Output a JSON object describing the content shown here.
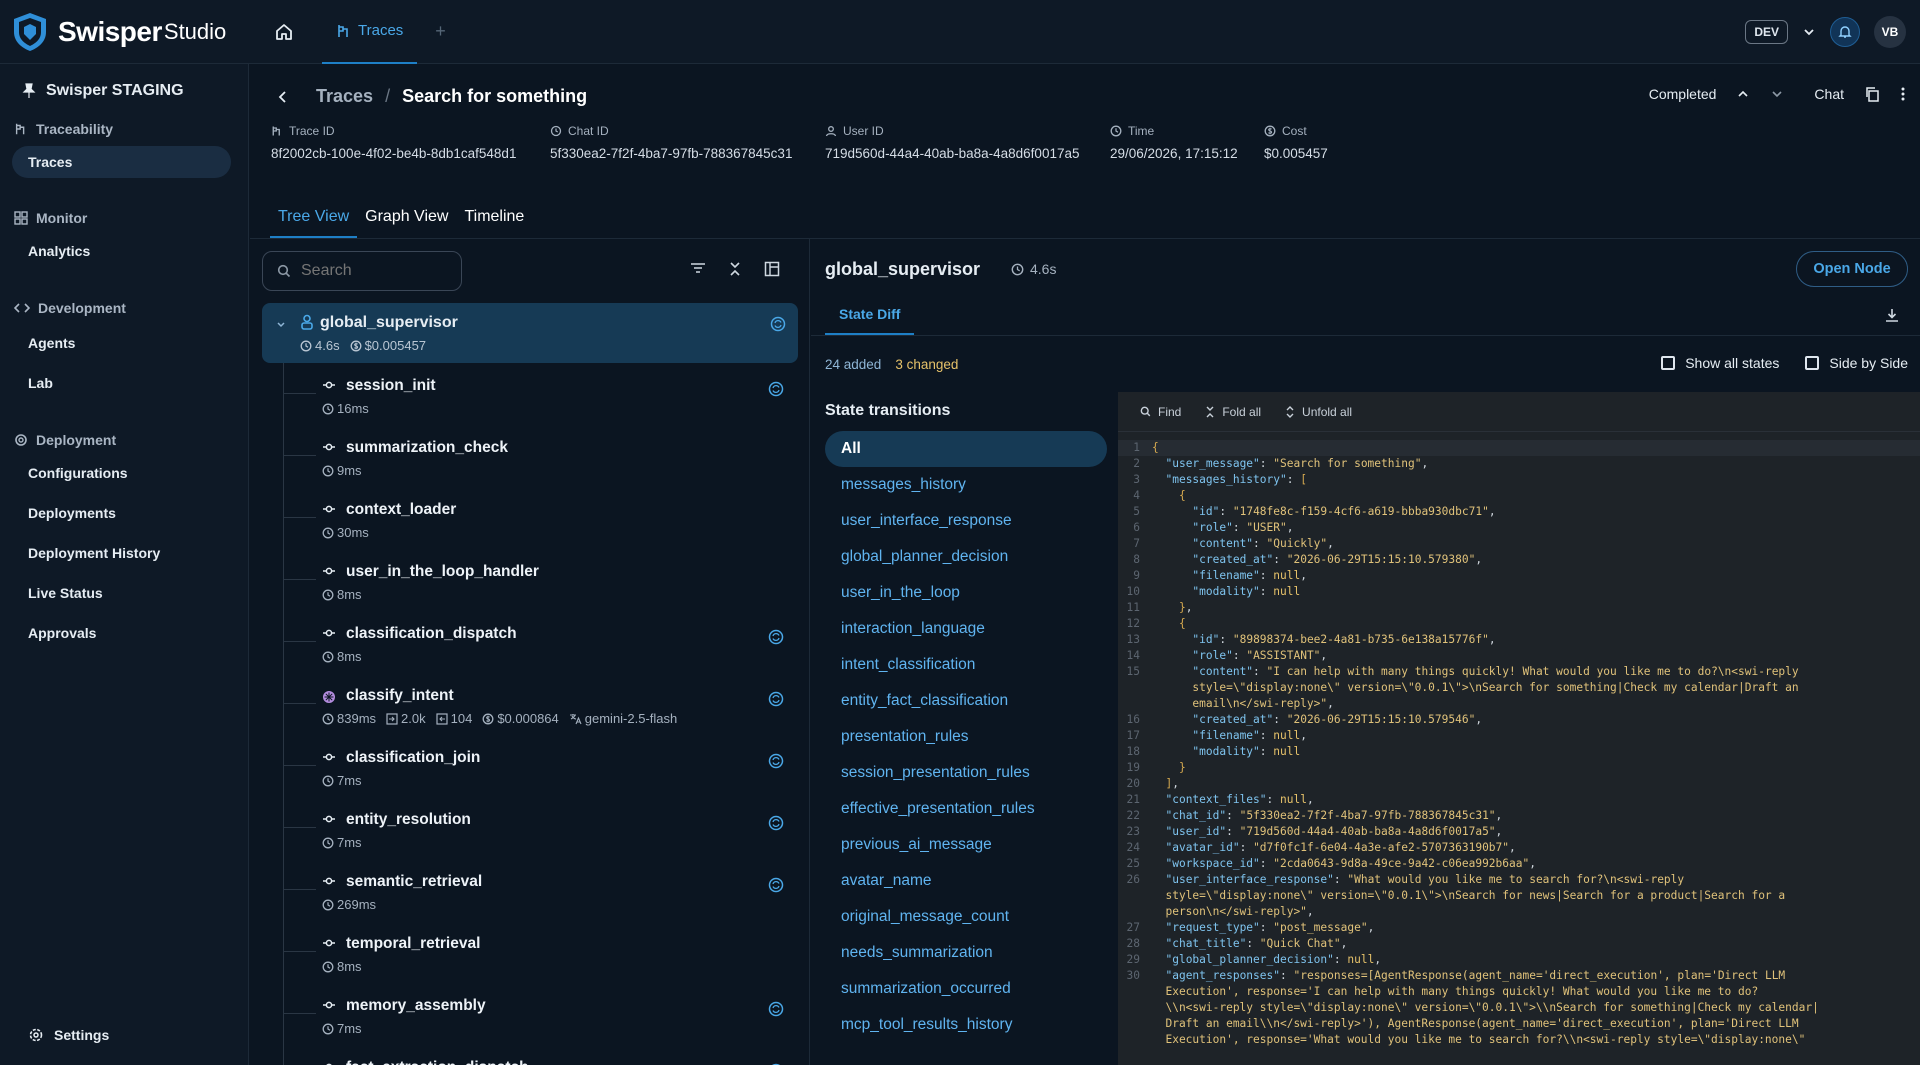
{
  "app": {
    "brand": "Swisper",
    "brand_suffix": "Studio",
    "env": "DEV",
    "user_initials": "VB"
  },
  "topbar": {
    "tab_label": "Traces"
  },
  "sidebar": {
    "workspace": "Swisper STAGING",
    "sections": {
      "traceability": "Traceability",
      "monitor": "Monitor",
      "development": "Development",
      "deployment": "Deployment"
    },
    "items": {
      "traces": "Traces",
      "analytics": "Analytics",
      "agents": "Agents",
      "lab": "Lab",
      "configurations": "Configurations",
      "deployments": "Deployments",
      "deployment_history": "Deployment History",
      "live_status": "Live Status",
      "approvals": "Approvals"
    },
    "settings": "Settings"
  },
  "header": {
    "breadcrumb_parent": "Traces",
    "breadcrumb_sep": "/",
    "title": "Search for something",
    "status": "Completed",
    "chat": "Chat",
    "meta": {
      "trace_id_label": "Trace ID",
      "trace_id": "8f2002cb-100e-4f02-be4b-8db1caf548d1",
      "chat_id_label": "Chat ID",
      "chat_id": "5f330ea2-7f2f-4ba7-97fb-788367845c31",
      "user_id_label": "User ID",
      "user_id": "719d560d-44a4-40ab-ba8a-4a8d6f0017a5",
      "time_label": "Time",
      "time": "29/06/2026, 17:15:12",
      "cost_label": "Cost",
      "cost": "$0.005457"
    },
    "tabs": {
      "tree": "Tree View",
      "graph": "Graph View",
      "timeline": "Timeline"
    }
  },
  "tree": {
    "search_placeholder": "Search",
    "root": {
      "name": "global_supervisor",
      "duration": "4.6s",
      "cost": "$0.005457"
    },
    "nodes": [
      {
        "name": "session_init",
        "duration": "16ms",
        "badge": true
      },
      {
        "name": "summarization_check",
        "duration": "9ms",
        "badge": false
      },
      {
        "name": "context_loader",
        "duration": "30ms",
        "badge": false
      },
      {
        "name": "user_in_the_loop_handler",
        "duration": "8ms",
        "badge": false
      },
      {
        "name": "classification_dispatch",
        "duration": "8ms",
        "badge": true
      },
      {
        "name": "classify_intent",
        "duration": "839ms",
        "tokens_in": "2.0k",
        "tokens_out": "104",
        "cost": "$0.000864",
        "model": "gemini-2.5-flash",
        "badge": true,
        "llm": true
      },
      {
        "name": "classification_join",
        "duration": "7ms",
        "badge": true
      },
      {
        "name": "entity_resolution",
        "duration": "7ms",
        "badge": true
      },
      {
        "name": "semantic_retrieval",
        "duration": "269ms",
        "badge": true
      },
      {
        "name": "temporal_retrieval",
        "duration": "8ms",
        "badge": false
      },
      {
        "name": "memory_assembly",
        "duration": "7ms",
        "badge": true
      },
      {
        "name": "fact_extraction_dispatch",
        "duration": "",
        "badge": true
      }
    ]
  },
  "detail": {
    "title": "global_supervisor",
    "duration": "4.6s",
    "open_node": "Open Node",
    "tab": "State Diff",
    "added": "24 added",
    "changed": "3 changed",
    "show_all_states": "Show all states",
    "side_by_side": "Side by Side",
    "transitions_title": "State transitions",
    "transitions": [
      "All",
      "messages_history",
      "user_interface_response",
      "global_planner_decision",
      "user_in_the_loop",
      "interaction_language",
      "intent_classification",
      "entity_fact_classification",
      "presentation_rules",
      "session_presentation_rules",
      "effective_presentation_rules",
      "previous_ai_message",
      "avatar_name",
      "original_message_count",
      "needs_summarization",
      "summarization_occurred",
      "mcp_tool_results_history"
    ],
    "code_tools": {
      "find": "Find",
      "fold": "Fold all",
      "unfold": "Unfold all"
    }
  }
}
